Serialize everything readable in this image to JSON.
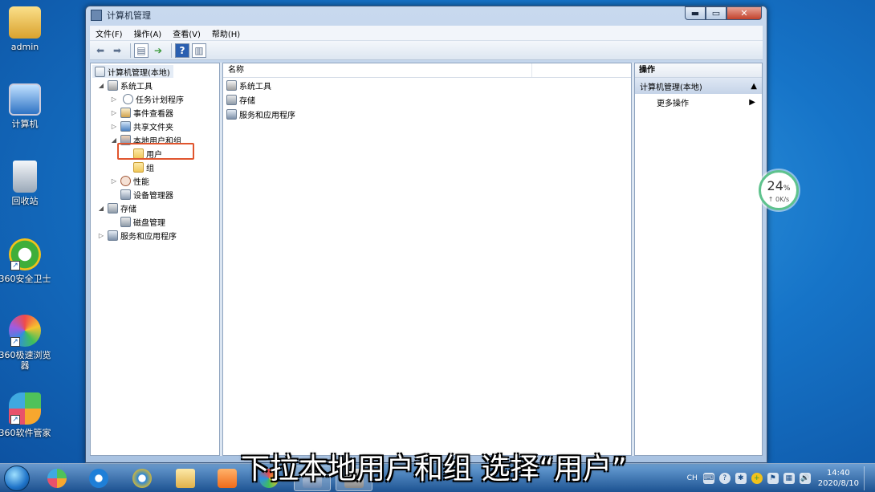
{
  "desktop": {
    "icons": [
      {
        "label": "admin",
        "color": "#e9b949"
      },
      {
        "label": "计算机",
        "color": "#4a8fd8"
      },
      {
        "label": "回收站",
        "color": "#cfd8e2"
      },
      {
        "label": "360安全卫士",
        "color": "#3fae3a"
      },
      {
        "label": "360极速浏览器",
        "color": "#2f8ee0"
      },
      {
        "label": "360软件管家",
        "color": "#4fc25a"
      }
    ]
  },
  "window": {
    "title": "计算机管理",
    "controls": {
      "minimize": "▬",
      "maximize": "▭",
      "close": "✕"
    },
    "menu": [
      "文件(F)",
      "操作(A)",
      "查看(V)",
      "帮助(H)"
    ]
  },
  "tree": {
    "root": "计算机管理(本地)",
    "items": [
      {
        "label": "系统工具",
        "level": 1,
        "expander": "◢",
        "icon": "tools-icon"
      },
      {
        "label": "任务计划程序",
        "level": 2,
        "expander": "▷",
        "icon": "clock-icon"
      },
      {
        "label": "事件查看器",
        "level": 2,
        "expander": "▷",
        "icon": "event-viewer-icon"
      },
      {
        "label": "共享文件夹",
        "level": 2,
        "expander": "▷",
        "icon": "shared-folder-icon"
      },
      {
        "label": "本地用户和组",
        "level": 2,
        "expander": "◢",
        "icon": "users-groups-icon"
      },
      {
        "label": "用户",
        "level": 3,
        "expander": "",
        "icon": "folder-icon"
      },
      {
        "label": "组",
        "level": 3,
        "expander": "",
        "icon": "folder-icon"
      },
      {
        "label": "性能",
        "level": 2,
        "expander": "▷",
        "icon": "performance-icon"
      },
      {
        "label": "设备管理器",
        "level": 2,
        "expander": "",
        "icon": "device-manager-icon"
      },
      {
        "label": "存储",
        "level": 1,
        "expander": "◢",
        "icon": "storage-icon"
      },
      {
        "label": "磁盘管理",
        "level": 2,
        "expander": "",
        "icon": "disk-icon"
      },
      {
        "label": "服务和应用程序",
        "level": 1,
        "expander": "▷",
        "icon": "services-icon"
      }
    ]
  },
  "list": {
    "column_name": "名称",
    "rows": [
      "系统工具",
      "存储",
      "服务和应用程序"
    ]
  },
  "actions": {
    "header": "操作",
    "section": "计算机管理(本地)",
    "section_arrow": "▲",
    "more": "更多操作",
    "more_arrow": "▶"
  },
  "net_widget": {
    "percent": "24",
    "unit": "%",
    "speed": "↑ 0K/s"
  },
  "taskbar": {
    "lang": "CH",
    "time": "14:40",
    "date": "2020/8/10"
  },
  "caption": "下拉本地用户和组 选择“用户”"
}
